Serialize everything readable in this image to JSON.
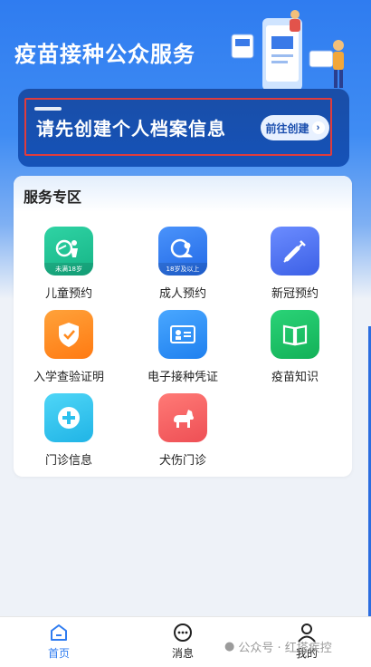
{
  "colors": {
    "primary": "#2f7cf0",
    "banner_bg": "#1552b8",
    "highlight": "#e03c3c",
    "active_tab": "#2f7cf0"
  },
  "header": {
    "title": "疫苗接种公众服务"
  },
  "banner": {
    "text": "请先创建个人档案信息",
    "button_label": "前往创建"
  },
  "services": {
    "title": "服务专区",
    "items": [
      {
        "label": "儿童预约",
        "icon": "child-icon",
        "badge": "未满18岁",
        "color": "#20c197"
      },
      {
        "label": "成人预约",
        "icon": "adult-icon",
        "badge": "18岁及以上",
        "color": "#2e7df3"
      },
      {
        "label": "新冠预约",
        "icon": "syringe-icon",
        "color": "#4c73f0"
      },
      {
        "label": "入学查验证明",
        "icon": "shield-icon",
        "color": "#ff8a1e"
      },
      {
        "label": "电子接种凭证",
        "icon": "id-card-icon",
        "color": "#3193f5"
      },
      {
        "label": "疫苗知识",
        "icon": "book-icon",
        "color": "#1dbf63"
      },
      {
        "label": "门诊信息",
        "icon": "medical-cross-icon",
        "color": "#2cc1ee"
      },
      {
        "label": "犬伤门诊",
        "icon": "dog-icon",
        "color": "#f45b5b"
      }
    ]
  },
  "tabbar": {
    "items": [
      {
        "label": "首页",
        "icon": "home-icon",
        "active": true
      },
      {
        "label": "消息",
        "icon": "message-icon",
        "active": false
      },
      {
        "label": "我的",
        "icon": "user-icon",
        "active": false
      }
    ]
  },
  "watermark": {
    "text": "公众号 · 红塔疾控"
  }
}
